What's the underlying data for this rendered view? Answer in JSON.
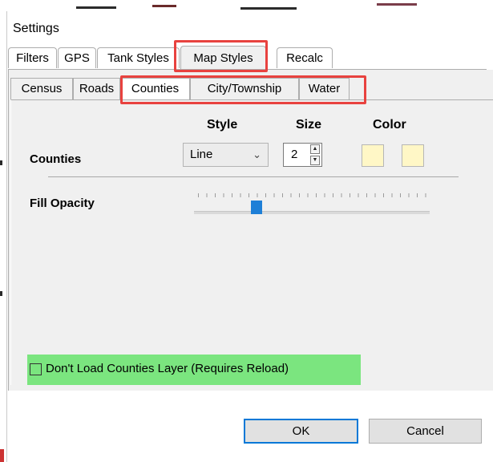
{
  "window": {
    "title": "Settings"
  },
  "outer_tabs": [
    {
      "label": "Filters"
    },
    {
      "label": "GPS"
    },
    {
      "label": "Tank Styles"
    },
    {
      "label": "Map Styles"
    },
    {
      "label": "Recalc"
    }
  ],
  "selected_outer_tab": "Map Styles",
  "inner_tabs": [
    {
      "label": "Census"
    },
    {
      "label": "Roads"
    },
    {
      "label": "Counties"
    },
    {
      "label": "City/Township"
    },
    {
      "label": "Water"
    }
  ],
  "selected_inner_tab": "Counties",
  "columns": {
    "style": "Style",
    "size": "Size",
    "color": "Color"
  },
  "counties_row": {
    "label": "Counties",
    "style_value": "Line",
    "size_value": "2",
    "color1": "#fff7c6",
    "color2": "#fff7c6"
  },
  "fill_opacity": {
    "label": "Fill Opacity",
    "level_fraction": 0.25
  },
  "dont_load": {
    "label": "Don't Load Counties Layer (Requires Reload)",
    "checked": false
  },
  "buttons": {
    "ok": "OK",
    "cancel": "Cancel"
  },
  "annotations": {
    "highlight_red": "#e8423f",
    "highlight_green": "#7be57f"
  }
}
